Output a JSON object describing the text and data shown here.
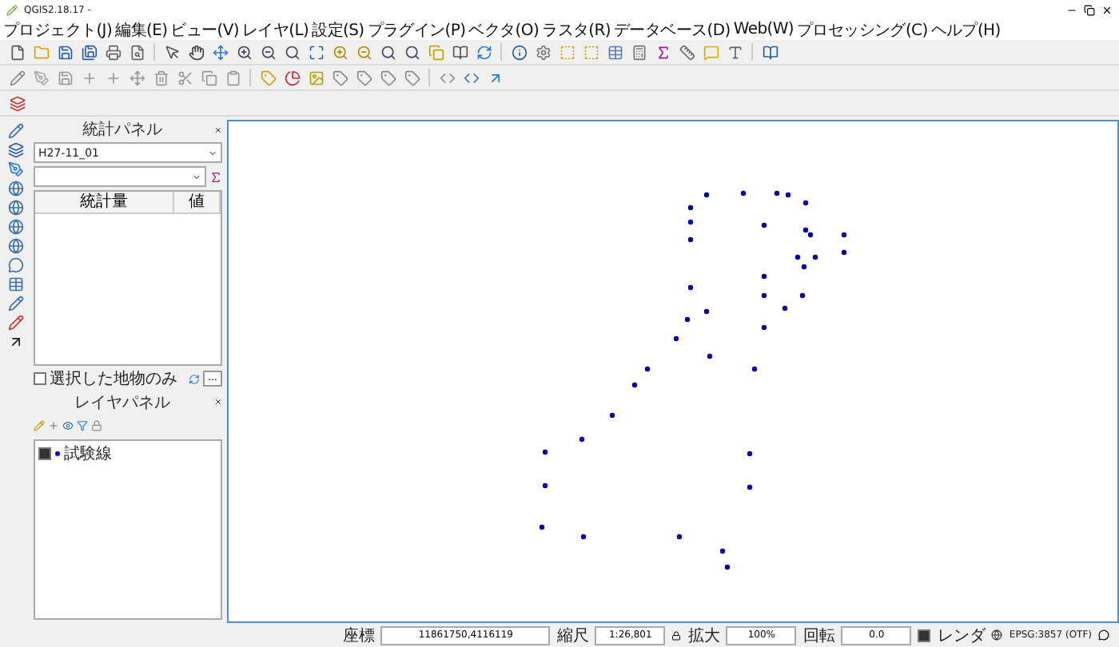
{
  "window": {
    "title": "QGIS2.18.17 -"
  },
  "menu": [
    "プロジェクト(J)",
    "編集(E)",
    "ビュー(V)",
    "レイヤ(L)",
    "設定(S)",
    "プラグイン(P)",
    "ベクタ(O)",
    "ラスタ(R)",
    "データベース(D)",
    "Web(W)",
    "プロセッシング(C)",
    "ヘルプ(H)"
  ],
  "stats_panel": {
    "title": "統計パネル",
    "layer": "H27-11_01",
    "columns": [
      "統計量",
      "値"
    ],
    "selected_only": {
      "label": "選択した地物のみ",
      "checked": false
    },
    "more_button": "..."
  },
  "layers_panel": {
    "title": "レイヤパネル",
    "layers": [
      {
        "name": "試験線",
        "visible": true
      }
    ]
  },
  "status_bar": {
    "coordinate_label": "座標",
    "coordinate": "11861750,4116119",
    "scale_label": "縮尺",
    "scale": "1:26,801",
    "magnifier_label": "拡大",
    "magnifier": "100%",
    "rotation_label": "回転",
    "rotation": "0.0",
    "render_label": "レンダ",
    "render": true,
    "crs": "EPSG:3857 (OTF)"
  }
}
